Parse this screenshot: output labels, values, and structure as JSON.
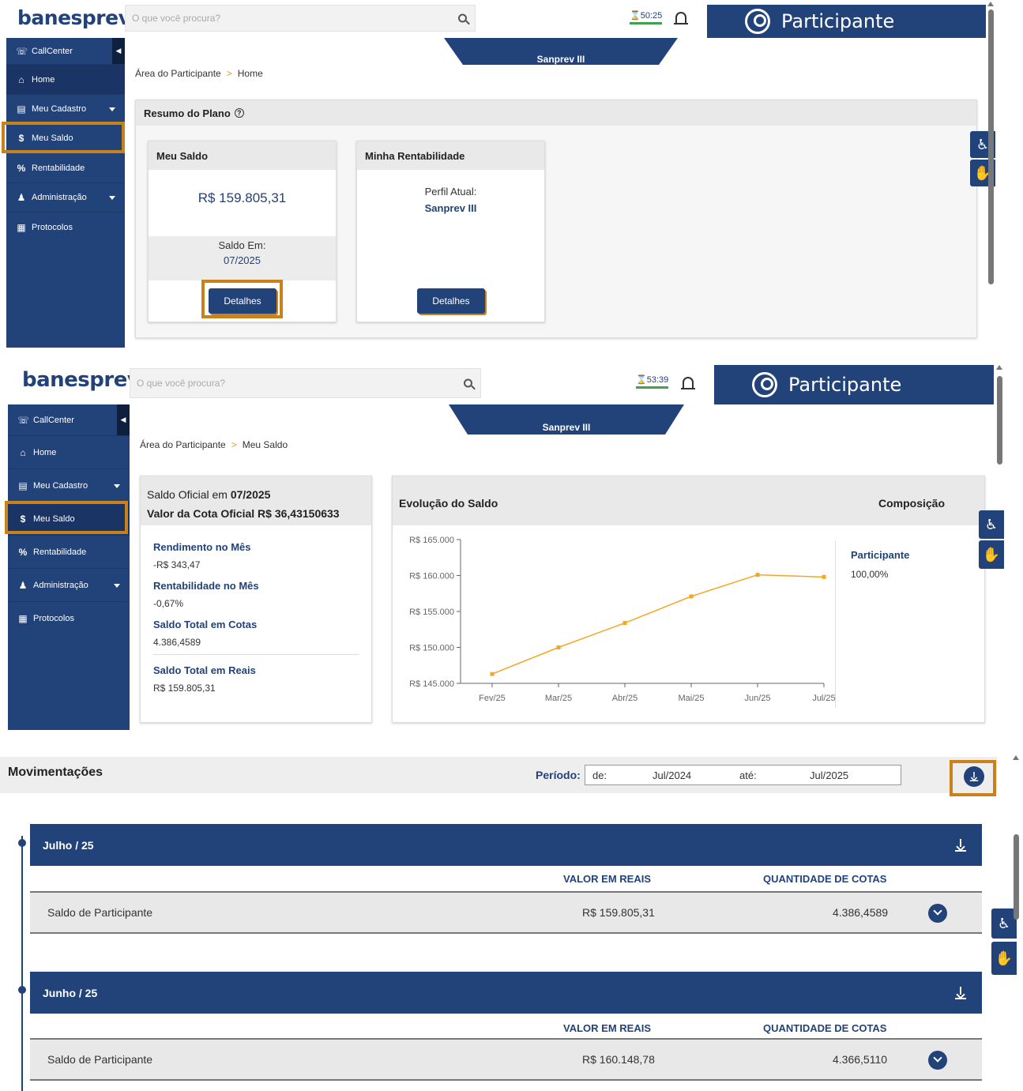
{
  "screens": {
    "home": {
      "logo": "banesprev",
      "search_placeholder": "O que você procura?",
      "timer": "50:25",
      "user": "Participante",
      "plan_tab": "Sanprev III",
      "sidebar": [
        {
          "label": "CallCenter",
          "icon": "headset-icon"
        },
        {
          "label": "Home",
          "icon": "home-icon"
        },
        {
          "label": "Meu Cadastro",
          "icon": "id-card-icon"
        },
        {
          "label": "Meu Saldo",
          "icon": "dollar-icon"
        },
        {
          "label": "Rentabilidade",
          "icon": "percent-icon"
        },
        {
          "label": "Administração",
          "icon": "users-icon"
        },
        {
          "label": "Protocolos",
          "icon": "archive-icon"
        }
      ],
      "breadcrumb": [
        "Área do Participante",
        "Home"
      ],
      "resumo_title": "Resumo do Plano",
      "meu_saldo": {
        "title": "Meu Saldo",
        "value": "R$ 159.805,31",
        "saldo_em_label": "Saldo Em:",
        "saldo_em": "07/2025",
        "button": "Detalhes"
      },
      "rentabilidade": {
        "title": "Minha Rentabilidade",
        "perfil_label": "Perfil Atual:",
        "perfil": "Sanprev III",
        "button": "Detalhes"
      }
    },
    "saldo": {
      "logo": "banesprev",
      "search_placeholder": "O que você procura?",
      "timer": "53:39",
      "user": "Participante",
      "plan_tab": "Sanprev III",
      "sidebar": [
        {
          "label": "CallCenter"
        },
        {
          "label": "Home"
        },
        {
          "label": "Meu Cadastro"
        },
        {
          "label": "Meu Saldo"
        },
        {
          "label": "Rentabilidade"
        },
        {
          "label": "Administração"
        },
        {
          "label": "Protocolos"
        }
      ],
      "breadcrumb": [
        "Área do Participante",
        "Meu Saldo"
      ],
      "oficial_line1_prefix": "Saldo Oficial em ",
      "oficial_line1_value": "07/2025",
      "oficial_line2_prefix": "Valor da Cota Oficial ",
      "oficial_line2_value": "R$ 36,43150633",
      "metrics": [
        {
          "label": "Rendimento no Mês",
          "value": "-R$ 343,47"
        },
        {
          "label": "Rentabilidade no Mês",
          "value": "-0,67%"
        },
        {
          "label": "Saldo Total em Cotas",
          "value": "4.386,4589"
        },
        {
          "label": "Saldo Total em Reais",
          "value": "R$ 159.805,31"
        }
      ],
      "evolucao_title": "Evolução do Saldo",
      "composicao_title": "Composição",
      "composicao": [
        {
          "label": "Participante",
          "value": "100,00%"
        }
      ]
    },
    "movimentacoes": {
      "title": "Movimentações",
      "periodo_label": "Período:",
      "de_label": "de:",
      "de_value": "Jul/2024",
      "ate_label": "até:",
      "ate_value": "Jul/2025",
      "col_valor": "VALOR EM REAIS",
      "col_cotas": "QUANTIDADE DE COTAS",
      "months": [
        {
          "label": "Julho / 25",
          "rows": [
            {
              "desc": "Saldo de Participante",
              "valor": "R$ 159.805,31",
              "cotas": "4.386,4589"
            }
          ]
        },
        {
          "label": "Junho / 25",
          "rows": [
            {
              "desc": "Saldo de Participante",
              "valor": "R$ 160.148,78",
              "cotas": "4.366,5110"
            }
          ]
        }
      ]
    }
  },
  "colors": {
    "primary": "#22427a",
    "highlight": "#c9821a",
    "line": "#f5a623"
  },
  "chart_data": {
    "type": "line",
    "title": "Evolução do Saldo",
    "categories": [
      "Fev/25",
      "Mar/25",
      "Abr/25",
      "Mai/25",
      "Jun/25",
      "Jul/25"
    ],
    "values": [
      146300,
      150000,
      153400,
      157100,
      160100,
      159800
    ],
    "y_ticks": [
      "R$ 145.000",
      "R$ 150.000",
      "R$ 155.000",
      "R$ 160.000",
      "R$ 165.000"
    ],
    "ylim": [
      145000,
      165000
    ],
    "grid": false
  }
}
